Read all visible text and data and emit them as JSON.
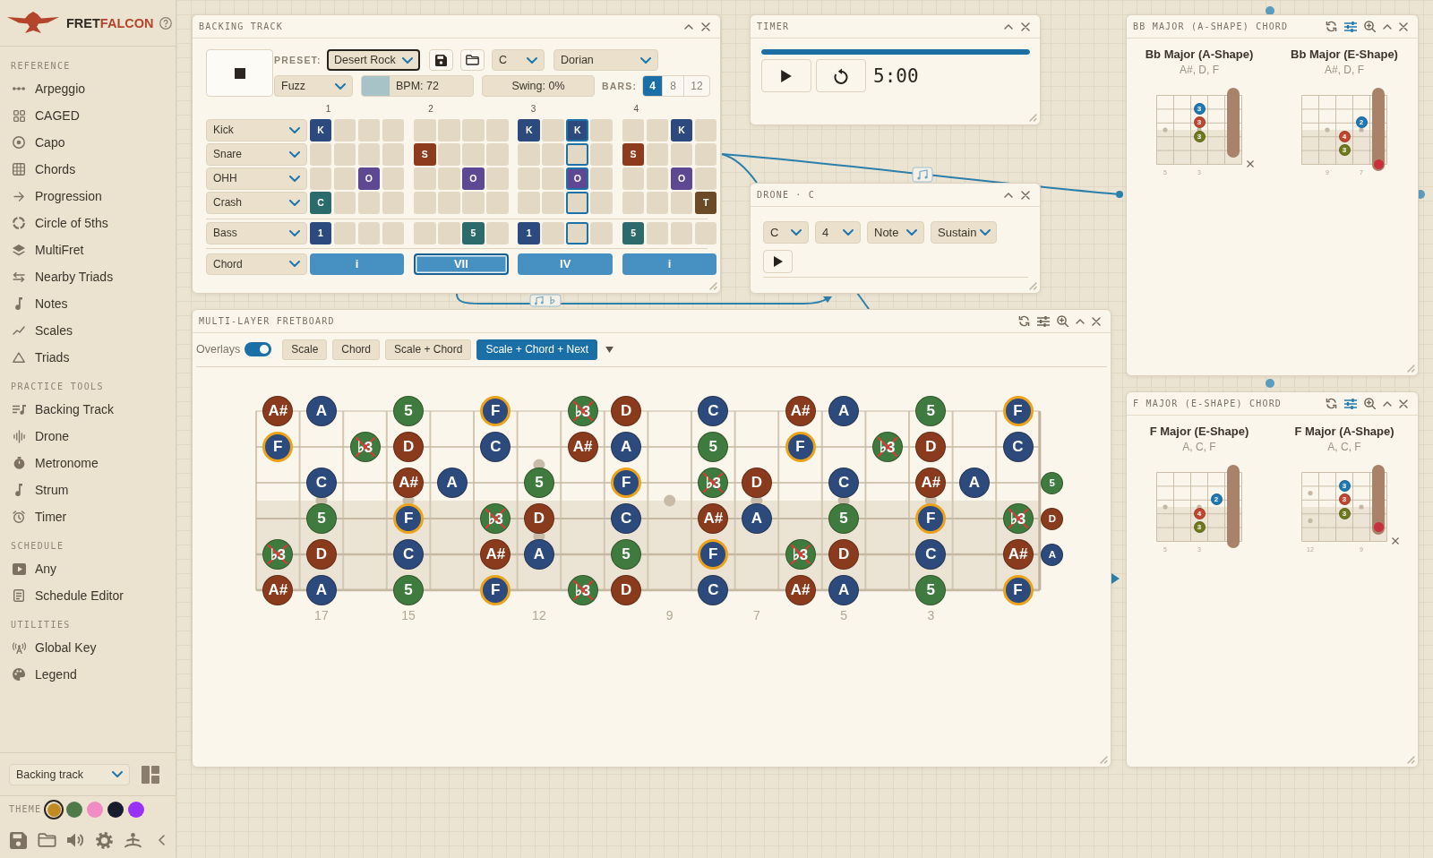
{
  "sidebar": {
    "logo": {
      "dark": "FRET",
      "accent": "FALCON"
    },
    "sections": [
      {
        "title": "REFERENCE",
        "items": [
          "Arpeggio",
          "CAGED",
          "Capo",
          "Chords",
          "Progression",
          "Circle of 5ths",
          "MultiFret",
          "Nearby Triads",
          "Notes",
          "Scales",
          "Triads"
        ]
      },
      {
        "title": "PRACTICE TOOLS",
        "items": [
          "Backing Track",
          "Drone",
          "Metronome",
          "Strum",
          "Timer"
        ]
      },
      {
        "title": "SCHEDULE",
        "items": [
          "Any",
          "Schedule Editor"
        ]
      },
      {
        "title": "UTILITIES",
        "items": [
          "Global Key",
          "Legend"
        ]
      }
    ],
    "layout_select": "Backing track",
    "theme": {
      "label": "THEME",
      "swatches": [
        {
          "color": "#c28a22",
          "selected": true
        },
        {
          "color": "#4f7b4b",
          "selected": false
        },
        {
          "color": "#f08bc3",
          "selected": false
        },
        {
          "color": "#161c2e",
          "selected": false
        },
        {
          "color": "#9a32f5",
          "selected": false
        }
      ]
    }
  },
  "backing_track": {
    "title": "BACKING TRACK",
    "playing": true,
    "preset_label": "PRESET:",
    "preset": {
      "value": "Desert Rock",
      "focused": true
    },
    "key": "C",
    "mode": "Dorian",
    "tone": "Fuzz",
    "bpm": {
      "text": "BPM: 72",
      "level": 0.25
    },
    "swing": {
      "text": "Swing: 0%"
    },
    "bars_label": "BARS:",
    "bars": [
      {
        "label": "4",
        "selected": true
      },
      {
        "label": "8",
        "selected": false
      },
      {
        "label": "12",
        "selected": false
      }
    ],
    "bar_numbers": [
      "1",
      "2",
      "3",
      "4"
    ],
    "step_columns": [
      {
        "current": false
      },
      {
        "current": false
      },
      {
        "current": false
      },
      {
        "current": false
      },
      {
        "current": false
      },
      {
        "current": false
      },
      {
        "current": false
      },
      {
        "current": false
      },
      {
        "current": false
      },
      {
        "current": false
      },
      {
        "current": true
      },
      {
        "current": false
      },
      {
        "current": false
      },
      {
        "current": false
      },
      {
        "current": false
      },
      {
        "current": false
      }
    ],
    "drums": [
      {
        "name": "Kick",
        "cells": [
          {
            "on": true,
            "text": "K",
            "color": "#2c4a7e"
          },
          {
            "on": false
          },
          {
            "on": false
          },
          {
            "on": false
          },
          {
            "on": false
          },
          {
            "on": false
          },
          {
            "on": false
          },
          {
            "on": false
          },
          {
            "on": true,
            "text": "K",
            "color": "#2c4a7e"
          },
          {
            "on": false
          },
          {
            "on": true,
            "text": "K",
            "color": "#2c4a7e"
          },
          {
            "on": false
          },
          {
            "on": false
          },
          {
            "on": false
          },
          {
            "on": true,
            "text": "K",
            "color": "#2c4a7e"
          },
          {
            "on": false
          }
        ]
      },
      {
        "name": "Snare",
        "cells": [
          {
            "on": false
          },
          {
            "on": false
          },
          {
            "on": false
          },
          {
            "on": false
          },
          {
            "on": true,
            "text": "S",
            "color": "#8e3a1c"
          },
          {
            "on": false
          },
          {
            "on": false
          },
          {
            "on": false
          },
          {
            "on": false
          },
          {
            "on": false
          },
          {
            "on": false
          },
          {
            "on": false
          },
          {
            "on": true,
            "text": "S",
            "color": "#8e3a1c"
          },
          {
            "on": false
          },
          {
            "on": false
          },
          {
            "on": false
          }
        ]
      },
      {
        "name": "OHH",
        "cells": [
          {
            "on": false
          },
          {
            "on": false
          },
          {
            "on": true,
            "text": "O",
            "color": "#5e4793"
          },
          {
            "on": false
          },
          {
            "on": false
          },
          {
            "on": false
          },
          {
            "on": true,
            "text": "O",
            "color": "#5e4793"
          },
          {
            "on": false
          },
          {
            "on": false
          },
          {
            "on": false
          },
          {
            "on": true,
            "text": "O",
            "color": "#5e4793"
          },
          {
            "on": false
          },
          {
            "on": false
          },
          {
            "on": false
          },
          {
            "on": true,
            "text": "O",
            "color": "#5e4793"
          },
          {
            "on": false
          }
        ]
      },
      {
        "name": "Crash",
        "cells": [
          {
            "on": true,
            "text": "C",
            "color": "#2c6b6b"
          },
          {
            "on": false
          },
          {
            "on": false
          },
          {
            "on": false
          },
          {
            "on": false
          },
          {
            "on": false
          },
          {
            "on": false
          },
          {
            "on": false
          },
          {
            "on": false
          },
          {
            "on": false
          },
          {
            "on": false
          },
          {
            "on": false
          },
          {
            "on": false
          },
          {
            "on": false
          },
          {
            "on": false
          },
          {
            "on": true,
            "text": "T",
            "color": "#6b4a28"
          }
        ]
      }
    ],
    "bass": {
      "name": "Bass",
      "cells": [
        {
          "on": true,
          "text": "1",
          "color": "#2c4a7e"
        },
        {
          "on": false
        },
        {
          "on": false
        },
        {
          "on": false
        },
        {
          "on": false
        },
        {
          "on": false
        },
        {
          "on": true,
          "text": "5",
          "color": "#2c6b6b"
        },
        {
          "on": false
        },
        {
          "on": true,
          "text": "1",
          "color": "#2c4a7e"
        },
        {
          "on": false
        },
        {
          "on": false
        },
        {
          "on": false
        },
        {
          "on": true,
          "text": "5",
          "color": "#2c6b6b"
        },
        {
          "on": false
        },
        {
          "on": false
        },
        {
          "on": false
        }
      ]
    },
    "chords": {
      "name": "Chord",
      "bars": [
        {
          "label": "i",
          "selected": false
        },
        {
          "label": "VII",
          "selected": true
        },
        {
          "label": "IV",
          "selected": false
        },
        {
          "label": "i",
          "selected": false
        }
      ]
    }
  },
  "timer": {
    "title": "TIMER",
    "progress": {
      "level": 1
    },
    "running": false,
    "time": "5:00"
  },
  "drone": {
    "title": "DRONE · C",
    "settings": [
      "C",
      "4",
      "Note",
      "Sustain"
    ],
    "playing": false
  },
  "fretboard": {
    "title": "MULTI-LAYER FRETBOARD",
    "options_active": false,
    "overlays": {
      "label": "Overlays",
      "on": true
    },
    "modes": [
      {
        "label": "Scale",
        "selected": false
      },
      {
        "label": "Chord",
        "selected": false
      },
      {
        "label": "Scale + Chord",
        "selected": false
      },
      {
        "label": "Scale + Chord + Next",
        "selected": true
      }
    ],
    "frets": [
      {
        "kind": "plain"
      },
      {
        "kind": "dot",
        "label": "17"
      },
      {
        "kind": "plain"
      },
      {
        "kind": "dot",
        "label": "15"
      },
      {
        "kind": "plain"
      },
      {
        "kind": "plain"
      },
      {
        "kind": "double",
        "label": "12"
      },
      {
        "kind": "plain"
      },
      {
        "kind": "plain"
      },
      {
        "kind": "dot",
        "label": "9"
      },
      {
        "kind": "plain"
      },
      {
        "kind": "dot",
        "label": "7"
      },
      {
        "kind": "plain"
      },
      {
        "kind": "dot",
        "label": "5"
      },
      {
        "kind": "plain"
      },
      {
        "kind": "dot",
        "label": "3"
      },
      {
        "kind": "plain"
      },
      {
        "kind": "plain"
      }
    ],
    "strings": [
      {
        "cells": [
          {
            "kind": "note",
            "note": "A#",
            "color": "#8b3b1d",
            "ring": false,
            "crossed": false
          },
          {
            "kind": "note",
            "note": "A",
            "color": "#2c4a7c",
            "ring": false,
            "crossed": false
          },
          {
            "kind": "empty"
          },
          {
            "kind": "note",
            "note": "5",
            "color": "#3f7b3e",
            "ring": false,
            "crossed": false
          },
          {
            "kind": "empty"
          },
          {
            "kind": "note",
            "note": "F",
            "color": "#2c4a7c",
            "ring": true,
            "crossed": false
          },
          {
            "kind": "empty"
          },
          {
            "kind": "note",
            "note": "♭3",
            "color": "#3f7b3e",
            "ring": false,
            "crossed": true
          },
          {
            "kind": "note",
            "note": "D",
            "color": "#8b3b1d",
            "ring": false,
            "crossed": false
          },
          {
            "kind": "empty"
          },
          {
            "kind": "note",
            "note": "C",
            "color": "#2c4a7c",
            "ring": false,
            "crossed": false
          },
          {
            "kind": "empty"
          },
          {
            "kind": "note",
            "note": "A#",
            "color": "#8b3b1d",
            "ring": false,
            "crossed": false
          },
          {
            "kind": "note",
            "note": "A",
            "color": "#2c4a7c",
            "ring": false,
            "crossed": false
          },
          {
            "kind": "empty"
          },
          {
            "kind": "note",
            "note": "5",
            "color": "#3f7b3e",
            "ring": false,
            "crossed": false
          },
          {
            "kind": "empty"
          },
          {
            "kind": "note",
            "note": "F",
            "color": "#2c4a7c",
            "ring": true,
            "crossed": false
          },
          {
            "kind": "empty"
          }
        ]
      },
      {
        "cells": [
          {
            "kind": "note",
            "note": "F",
            "color": "#2c4a7c",
            "ring": true,
            "crossed": false
          },
          {
            "kind": "empty"
          },
          {
            "kind": "note",
            "note": "♭3",
            "color": "#3f7b3e",
            "ring": false,
            "crossed": true
          },
          {
            "kind": "note",
            "note": "D",
            "color": "#8b3b1d",
            "ring": false,
            "crossed": false
          },
          {
            "kind": "empty"
          },
          {
            "kind": "note",
            "note": "C",
            "color": "#2c4a7c",
            "ring": false,
            "crossed": false
          },
          {
            "kind": "empty"
          },
          {
            "kind": "note",
            "note": "A#",
            "color": "#8b3b1d",
            "ring": false,
            "crossed": false
          },
          {
            "kind": "note",
            "note": "A",
            "color": "#2c4a7c",
            "ring": false,
            "crossed": false
          },
          {
            "kind": "empty"
          },
          {
            "kind": "note",
            "note": "5",
            "color": "#3f7b3e",
            "ring": false,
            "crossed": false
          },
          {
            "kind": "empty"
          },
          {
            "kind": "note",
            "note": "F",
            "color": "#2c4a7c",
            "ring": true,
            "crossed": false
          },
          {
            "kind": "empty"
          },
          {
            "kind": "note",
            "note": "♭3",
            "color": "#3f7b3e",
            "ring": false,
            "crossed": true
          },
          {
            "kind": "note",
            "note": "D",
            "color": "#8b3b1d",
            "ring": false,
            "crossed": false
          },
          {
            "kind": "empty"
          },
          {
            "kind": "note",
            "note": "C",
            "color": "#2c4a7c",
            "ring": false,
            "crossed": false
          },
          {
            "kind": "empty"
          }
        ]
      },
      {
        "cells": [
          {
            "kind": "empty"
          },
          {
            "kind": "note",
            "note": "C",
            "color": "#2c4a7c",
            "ring": false,
            "crossed": false
          },
          {
            "kind": "empty"
          },
          {
            "kind": "note",
            "note": "A#",
            "color": "#8b3b1d",
            "ring": false,
            "crossed": false
          },
          {
            "kind": "note",
            "note": "A",
            "color": "#2c4a7c",
            "ring": false,
            "crossed": false
          },
          {
            "kind": "empty"
          },
          {
            "kind": "note",
            "note": "5",
            "color": "#3f7b3e",
            "ring": false,
            "crossed": false
          },
          {
            "kind": "empty"
          },
          {
            "kind": "note",
            "note": "F",
            "color": "#2c4a7c",
            "ring": true,
            "crossed": false
          },
          {
            "kind": "empty"
          },
          {
            "kind": "note",
            "note": "♭3",
            "color": "#3f7b3e",
            "ring": false,
            "crossed": true
          },
          {
            "kind": "note",
            "note": "D",
            "color": "#8b3b1d",
            "ring": false,
            "crossed": false
          },
          {
            "kind": "empty"
          },
          {
            "kind": "note",
            "note": "C",
            "color": "#2c4a7c",
            "ring": false,
            "crossed": false
          },
          {
            "kind": "empty"
          },
          {
            "kind": "note",
            "note": "A#",
            "color": "#8b3b1d",
            "ring": false,
            "crossed": false
          },
          {
            "kind": "note",
            "note": "A",
            "color": "#2c4a7c",
            "ring": false,
            "crossed": false
          },
          {
            "kind": "empty"
          },
          {
            "kind": "note",
            "note": "5",
            "color": "#3f7b3e",
            "ring": false,
            "crossed": false
          }
        ]
      },
      {
        "cells": [
          {
            "kind": "empty"
          },
          {
            "kind": "note",
            "note": "5",
            "color": "#3f7b3e",
            "ring": false,
            "crossed": false
          },
          {
            "kind": "empty"
          },
          {
            "kind": "note",
            "note": "F",
            "color": "#2c4a7c",
            "ring": true,
            "crossed": false
          },
          {
            "kind": "empty"
          },
          {
            "kind": "note",
            "note": "♭3",
            "color": "#3f7b3e",
            "ring": false,
            "crossed": true
          },
          {
            "kind": "note",
            "note": "D",
            "color": "#8b3b1d",
            "ring": false,
            "crossed": false
          },
          {
            "kind": "empty"
          },
          {
            "kind": "note",
            "note": "C",
            "color": "#2c4a7c",
            "ring": false,
            "crossed": false
          },
          {
            "kind": "empty"
          },
          {
            "kind": "note",
            "note": "A#",
            "color": "#8b3b1d",
            "ring": false,
            "crossed": false
          },
          {
            "kind": "note",
            "note": "A",
            "color": "#2c4a7c",
            "ring": false,
            "crossed": false
          },
          {
            "kind": "empty"
          },
          {
            "kind": "note",
            "note": "5",
            "color": "#3f7b3e",
            "ring": false,
            "crossed": false
          },
          {
            "kind": "empty"
          },
          {
            "kind": "note",
            "note": "F",
            "color": "#2c4a7c",
            "ring": true,
            "crossed": false
          },
          {
            "kind": "empty"
          },
          {
            "kind": "note",
            "note": "♭3",
            "color": "#3f7b3e",
            "ring": false,
            "crossed": true
          },
          {
            "kind": "note",
            "note": "D",
            "color": "#8b3b1d",
            "ring": false,
            "crossed": false
          }
        ]
      },
      {
        "cells": [
          {
            "kind": "note",
            "note": "♭3",
            "color": "#3f7b3e",
            "ring": false,
            "crossed": true
          },
          {
            "kind": "note",
            "note": "D",
            "color": "#8b3b1d",
            "ring": false,
            "crossed": false
          },
          {
            "kind": "empty"
          },
          {
            "kind": "note",
            "note": "C",
            "color": "#2c4a7c",
            "ring": false,
            "crossed": false
          },
          {
            "kind": "empty"
          },
          {
            "kind": "note",
            "note": "A#",
            "color": "#8b3b1d",
            "ring": false,
            "crossed": false
          },
          {
            "kind": "note",
            "note": "A",
            "color": "#2c4a7c",
            "ring": false,
            "crossed": false
          },
          {
            "kind": "empty"
          },
          {
            "kind": "note",
            "note": "5",
            "color": "#3f7b3e",
            "ring": false,
            "crossed": false
          },
          {
            "kind": "empty"
          },
          {
            "kind": "note",
            "note": "F",
            "color": "#2c4a7c",
            "ring": true,
            "crossed": false
          },
          {
            "kind": "empty"
          },
          {
            "kind": "note",
            "note": "♭3",
            "color": "#3f7b3e",
            "ring": false,
            "crossed": true
          },
          {
            "kind": "note",
            "note": "D",
            "color": "#8b3b1d",
            "ring": false,
            "crossed": false
          },
          {
            "kind": "empty"
          },
          {
            "kind": "note",
            "note": "C",
            "color": "#2c4a7c",
            "ring": false,
            "crossed": false
          },
          {
            "kind": "empty"
          },
          {
            "kind": "note",
            "note": "A#",
            "color": "#8b3b1d",
            "ring": false,
            "crossed": false
          },
          {
            "kind": "note",
            "note": "A",
            "color": "#2c4a7c",
            "ring": false,
            "crossed": false
          }
        ]
      },
      {
        "cells": [
          {
            "kind": "note",
            "note": "A#",
            "color": "#8b3b1d",
            "ring": false,
            "crossed": false
          },
          {
            "kind": "note",
            "note": "A",
            "color": "#2c4a7c",
            "ring": false,
            "crossed": false
          },
          {
            "kind": "empty"
          },
          {
            "kind": "note",
            "note": "5",
            "color": "#3f7b3e",
            "ring": false,
            "crossed": false
          },
          {
            "kind": "empty"
          },
          {
            "kind": "note",
            "note": "F",
            "color": "#2c4a7c",
            "ring": true,
            "crossed": false
          },
          {
            "kind": "empty"
          },
          {
            "kind": "note",
            "note": "♭3",
            "color": "#3f7b3e",
            "ring": false,
            "crossed": true
          },
          {
            "kind": "note",
            "note": "D",
            "color": "#8b3b1d",
            "ring": false,
            "crossed": false
          },
          {
            "kind": "empty"
          },
          {
            "kind": "note",
            "note": "C",
            "color": "#2c4a7c",
            "ring": false,
            "crossed": false
          },
          {
            "kind": "empty"
          },
          {
            "kind": "note",
            "note": "A#",
            "color": "#8b3b1d",
            "ring": false,
            "crossed": false
          },
          {
            "kind": "note",
            "note": "A",
            "color": "#2c4a7c",
            "ring": false,
            "crossed": false
          },
          {
            "kind": "empty"
          },
          {
            "kind": "note",
            "note": "5",
            "color": "#3f7b3e",
            "ring": false,
            "crossed": false
          },
          {
            "kind": "empty"
          },
          {
            "kind": "note",
            "note": "F",
            "color": "#2c4a7c",
            "ring": true,
            "crossed": false
          },
          {
            "kind": "empty"
          }
        ]
      }
    ]
  },
  "chord_panels": [
    {
      "title": "BB MAJOR (A-SHAPE) CHORD",
      "options_active": true,
      "chords": [
        {
          "name": "Bb Major (A-Shape)",
          "notes": "A#, D, F",
          "diagram": {
            "slots": [
              {
                "kind": "dot",
                "label": "5"
              },
              {
                "kind": "plain"
              },
              {
                "kind": "dot",
                "label": "3"
              },
              {
                "kind": "plain"
              },
              {
                "kind": "plain"
              }
            ],
            "strings": [
              {
                "kind": "played",
                "cells": [
                  {
                    "kind": "empty"
                  },
                  {
                    "kind": "empty"
                  },
                  {
                    "kind": "empty"
                  },
                  {
                    "kind": "empty"
                  },
                  {
                    "kind": "barre"
                  }
                ]
              },
              {
                "kind": "played",
                "cells": [
                  {
                    "kind": "empty"
                  },
                  {
                    "kind": "empty"
                  },
                  {
                    "kind": "finger",
                    "text": "3",
                    "color": "#1f79b4"
                  },
                  {
                    "kind": "empty"
                  },
                  {
                    "kind": "barre"
                  }
                ]
              },
              {
                "kind": "played",
                "cells": [
                  {
                    "kind": "empty"
                  },
                  {
                    "kind": "empty"
                  },
                  {
                    "kind": "finger",
                    "text": "3",
                    "color": "#c3462f"
                  },
                  {
                    "kind": "empty"
                  },
                  {
                    "kind": "barre"
                  }
                ]
              },
              {
                "kind": "played",
                "cells": [
                  {
                    "kind": "empty"
                  },
                  {
                    "kind": "empty"
                  },
                  {
                    "kind": "finger",
                    "text": "3",
                    "color": "#6f7a1d"
                  },
                  {
                    "kind": "empty"
                  },
                  {
                    "kind": "barre"
                  }
                ]
              },
              {
                "kind": "played",
                "cells": [
                  {
                    "kind": "empty"
                  },
                  {
                    "kind": "empty"
                  },
                  {
                    "kind": "empty"
                  },
                  {
                    "kind": "empty"
                  },
                  {
                    "kind": "barre"
                  }
                ]
              },
              {
                "kind": "muted",
                "cells": [
                  {
                    "kind": "empty"
                  },
                  {
                    "kind": "empty"
                  },
                  {
                    "kind": "empty"
                  },
                  {
                    "kind": "empty"
                  },
                  {
                    "kind": "empty"
                  }
                ]
              }
            ]
          }
        },
        {
          "name": "Bb Major (E-Shape)",
          "notes": "A#, D, F",
          "diagram": {
            "slots": [
              {
                "kind": "plain"
              },
              {
                "kind": "dot",
                "label": "9"
              },
              {
                "kind": "plain"
              },
              {
                "kind": "dot",
                "label": "7"
              },
              {
                "kind": "plain"
              }
            ],
            "strings": [
              {
                "kind": "played",
                "cells": [
                  {
                    "kind": "empty"
                  },
                  {
                    "kind": "empty"
                  },
                  {
                    "kind": "empty"
                  },
                  {
                    "kind": "empty"
                  },
                  {
                    "kind": "barre"
                  }
                ]
              },
              {
                "kind": "played",
                "cells": [
                  {
                    "kind": "empty"
                  },
                  {
                    "kind": "empty"
                  },
                  {
                    "kind": "empty"
                  },
                  {
                    "kind": "empty"
                  },
                  {
                    "kind": "barre"
                  }
                ]
              },
              {
                "kind": "played",
                "cells": [
                  {
                    "kind": "empty"
                  },
                  {
                    "kind": "empty"
                  },
                  {
                    "kind": "empty"
                  },
                  {
                    "kind": "finger",
                    "text": "2",
                    "color": "#1f79b4"
                  },
                  {
                    "kind": "barre"
                  }
                ]
              },
              {
                "kind": "played",
                "cells": [
                  {
                    "kind": "empty"
                  },
                  {
                    "kind": "empty"
                  },
                  {
                    "kind": "finger",
                    "text": "4",
                    "color": "#c3462f"
                  },
                  {
                    "kind": "empty"
                  },
                  {
                    "kind": "barre"
                  }
                ]
              },
              {
                "kind": "played",
                "cells": [
                  {
                    "kind": "empty"
                  },
                  {
                    "kind": "empty"
                  },
                  {
                    "kind": "finger",
                    "text": "3",
                    "color": "#6f7a1d"
                  },
                  {
                    "kind": "empty"
                  },
                  {
                    "kind": "barre"
                  }
                ]
              },
              {
                "kind": "played",
                "cells": [
                  {
                    "kind": "empty"
                  },
                  {
                    "kind": "empty"
                  },
                  {
                    "kind": "empty"
                  },
                  {
                    "kind": "empty"
                  },
                  {
                    "kind": "root"
                  }
                ]
              }
            ]
          }
        }
      ]
    },
    {
      "title": "F MAJOR (E-SHAPE) CHORD",
      "options_active": true,
      "chords": [
        {
          "name": "F Major (E-Shape)",
          "notes": "A, C, F",
          "diagram": {
            "slots": [
              {
                "kind": "dot",
                "label": "5"
              },
              {
                "kind": "plain"
              },
              {
                "kind": "dot",
                "label": "3"
              },
              {
                "kind": "plain"
              },
              {
                "kind": "plain"
              }
            ],
            "strings": [
              {
                "kind": "played",
                "cells": [
                  {
                    "kind": "empty"
                  },
                  {
                    "kind": "empty"
                  },
                  {
                    "kind": "empty"
                  },
                  {
                    "kind": "empty"
                  },
                  {
                    "kind": "barre"
                  }
                ]
              },
              {
                "kind": "played",
                "cells": [
                  {
                    "kind": "empty"
                  },
                  {
                    "kind": "empty"
                  },
                  {
                    "kind": "empty"
                  },
                  {
                    "kind": "empty"
                  },
                  {
                    "kind": "barre"
                  }
                ]
              },
              {
                "kind": "played",
                "cells": [
                  {
                    "kind": "empty"
                  },
                  {
                    "kind": "empty"
                  },
                  {
                    "kind": "empty"
                  },
                  {
                    "kind": "finger",
                    "text": "2",
                    "color": "#1f79b4"
                  },
                  {
                    "kind": "barre"
                  }
                ]
              },
              {
                "kind": "played",
                "cells": [
                  {
                    "kind": "empty"
                  },
                  {
                    "kind": "empty"
                  },
                  {
                    "kind": "finger",
                    "text": "4",
                    "color": "#c3462f"
                  },
                  {
                    "kind": "empty"
                  },
                  {
                    "kind": "barre"
                  }
                ]
              },
              {
                "kind": "played",
                "cells": [
                  {
                    "kind": "empty"
                  },
                  {
                    "kind": "empty"
                  },
                  {
                    "kind": "finger",
                    "text": "3",
                    "color": "#6f7a1d"
                  },
                  {
                    "kind": "empty"
                  },
                  {
                    "kind": "barre"
                  }
                ]
              },
              {
                "kind": "played",
                "cells": [
                  {
                    "kind": "empty"
                  },
                  {
                    "kind": "empty"
                  },
                  {
                    "kind": "empty"
                  },
                  {
                    "kind": "empty"
                  },
                  {
                    "kind": "barre"
                  }
                ]
              }
            ]
          }
        },
        {
          "name": "F Major (A-Shape)",
          "notes": "A, C, F",
          "diagram": {
            "slots": [
              {
                "kind": "double",
                "label": "12"
              },
              {
                "kind": "plain"
              },
              {
                "kind": "plain"
              },
              {
                "kind": "dot",
                "label": "9"
              },
              {
                "kind": "plain"
              }
            ],
            "strings": [
              {
                "kind": "played",
                "cells": [
                  {
                    "kind": "empty"
                  },
                  {
                    "kind": "empty"
                  },
                  {
                    "kind": "empty"
                  },
                  {
                    "kind": "empty"
                  },
                  {
                    "kind": "barre"
                  }
                ]
              },
              {
                "kind": "played",
                "cells": [
                  {
                    "kind": "empty"
                  },
                  {
                    "kind": "empty"
                  },
                  {
                    "kind": "finger",
                    "text": "3",
                    "color": "#1f79b4"
                  },
                  {
                    "kind": "empty"
                  },
                  {
                    "kind": "barre"
                  }
                ]
              },
              {
                "kind": "played",
                "cells": [
                  {
                    "kind": "empty"
                  },
                  {
                    "kind": "empty"
                  },
                  {
                    "kind": "finger",
                    "text": "3",
                    "color": "#c3462f"
                  },
                  {
                    "kind": "empty"
                  },
                  {
                    "kind": "barre"
                  }
                ]
              },
              {
                "kind": "played",
                "cells": [
                  {
                    "kind": "empty"
                  },
                  {
                    "kind": "empty"
                  },
                  {
                    "kind": "finger",
                    "text": "3",
                    "color": "#6f7a1d"
                  },
                  {
                    "kind": "empty"
                  },
                  {
                    "kind": "barre"
                  }
                ]
              },
              {
                "kind": "played",
                "cells": [
                  {
                    "kind": "empty"
                  },
                  {
                    "kind": "empty"
                  },
                  {
                    "kind": "empty"
                  },
                  {
                    "kind": "empty"
                  },
                  {
                    "kind": "root"
                  }
                ]
              },
              {
                "kind": "muted",
                "cells": [
                  {
                    "kind": "empty"
                  },
                  {
                    "kind": "empty"
                  },
                  {
                    "kind": "empty"
                  },
                  {
                    "kind": "empty"
                  },
                  {
                    "kind": "empty"
                  }
                ]
              }
            ]
          }
        }
      ]
    }
  ]
}
